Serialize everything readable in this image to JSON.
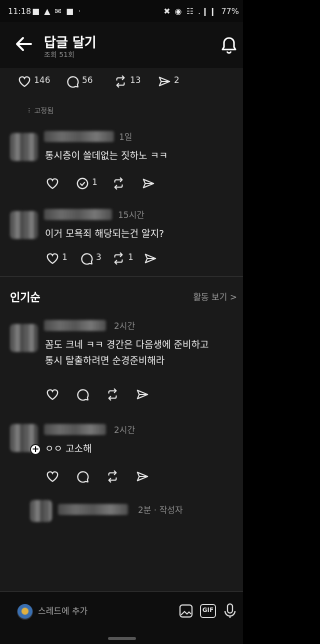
{
  "status_bar": {
    "time": "11:18",
    "left_icons": "■ ▲ ✉ ■ ·",
    "right_icons": "✖ ◉ ☷ .❙❙",
    "battery": "77%"
  },
  "header": {
    "title": "답글 달기",
    "views": "조회 51회"
  },
  "post_actions": {
    "likes": "146",
    "comments": "56",
    "reposts": "13",
    "shares": "2"
  },
  "pinned_label": "고정됨",
  "comments": [
    {
      "time": "1일",
      "text": "통시층이 쓸데없는 짓하노 ㅋㅋ",
      "reply_count": "1"
    },
    {
      "time": "15시간",
      "text": "이거 모욕죄 해당되는건 알지?",
      "likes": "1",
      "replies": "3",
      "reposts": "1"
    }
  ],
  "popular": {
    "label": "인기순",
    "activity": "활동 보기 >"
  },
  "popular_comments": [
    {
      "time": "2시간",
      "text_line1": "꼼도 크네 ㅋㅋ 경간은 다음생에 준비하고",
      "text_line2": "통시 탈출하려면 순경준비해라"
    },
    {
      "time": "2시간",
      "text": "ㅇㅇ 고소해"
    }
  ],
  "draft": {
    "meta": "2분 · 작성자"
  },
  "bottom_bar": {
    "placeholder": "스레드에 추가",
    "gif_label": "GIF"
  },
  "colors": {
    "background": "#000000",
    "thread_background": "#1a1a1a",
    "text": "#f0f0f0",
    "muted": "#8a8a8a"
  }
}
